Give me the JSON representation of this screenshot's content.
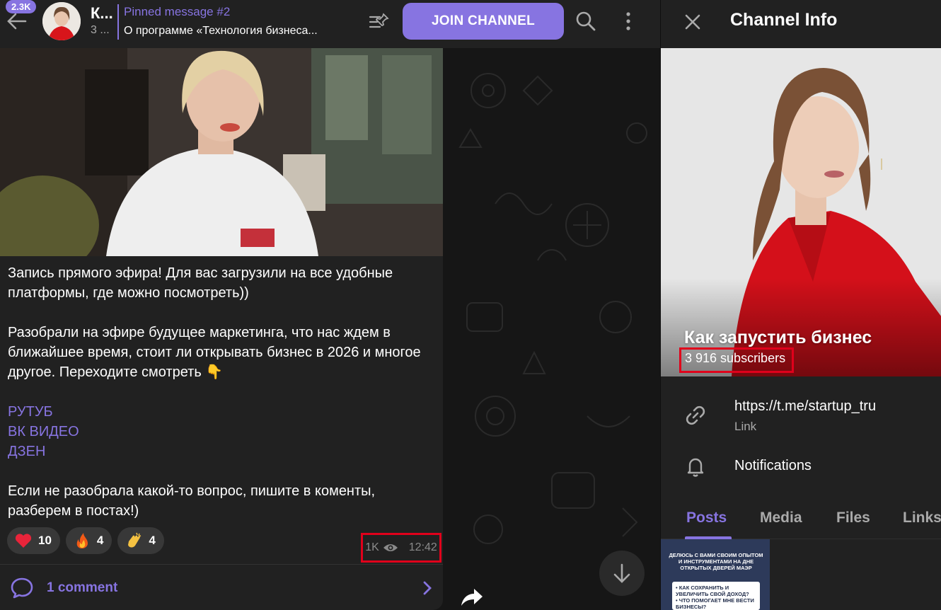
{
  "header": {
    "unread_badge": "2.3K",
    "channel_title": "К...",
    "subtitle": "3 ...",
    "pinned_label": "Pinned message #2",
    "pinned_text": "О программе «Технология бизнеса...",
    "join_label": "JOIN CHANNEL"
  },
  "message": {
    "paragraphs": [
      "Запись прямого эфира! Для вас загрузили на все удобные платформы, где можно посмотреть))",
      "Разобрали на эфире будущее маркетинга, что нас ждем в ближайшее время, стоит ли открывать бизнес в 2026 и многое другое. Переходите смотреть 👇"
    ],
    "links": [
      "РУТУБ",
      "ВК ВИДЕО",
      "ДЗЕН"
    ],
    "closing": "Если не разобрала какой-то вопрос, пишите в коменты, разберем в постах!)",
    "reactions": [
      {
        "icon": "heart-icon",
        "count": "10"
      },
      {
        "icon": "fire-icon",
        "count": "4"
      },
      {
        "icon": "clap-icon",
        "count": "4"
      }
    ],
    "views": "1K",
    "time": "12:42",
    "comments_label": "1 comment"
  },
  "panel": {
    "title": "Channel Info",
    "channel_name": "Как запустить бизнес",
    "subscribers": "3 916 subscribers",
    "link": "https://t.me/startup_tru",
    "link_caption": "Link",
    "notifications_label": "Notifications",
    "tabs": [
      "Posts",
      "Media",
      "Files",
      "Links"
    ],
    "active_tab": "Posts",
    "thumb_heading": "ДЕЛЮСЬ С ВАМИ СВОИМ ОПЫТОМ И ИНСТРУМЕНТАМИ НА ДНЕ ОТКРЫТЫХ ДВЕРЕЙ МАЭР",
    "thumb_items": [
      "• КАК СОХРАНИТЬ И УВЕЛИЧИТЬ СВОЙ ДОХОД?",
      "• ЧТО ПОМОГАЕТ МНЕ ВЕСТИ БИЗНЕСЫ?"
    ]
  },
  "colors": {
    "accent": "#8774e1",
    "highlight_box": "#e0001b",
    "panel_bg": "#212121"
  }
}
